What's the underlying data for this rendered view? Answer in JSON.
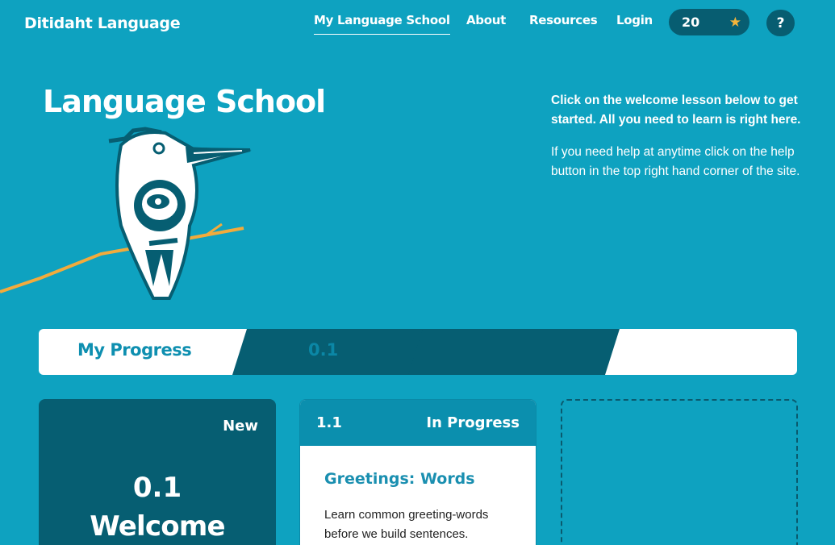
{
  "brand": "Ditidaht Language",
  "nav": {
    "items": [
      {
        "label": "My Language School",
        "active": true
      },
      {
        "label": "About",
        "active": false
      },
      {
        "label": "Resources",
        "active": false
      },
      {
        "label": "Login",
        "active": false
      }
    ],
    "stars_count": "20",
    "help_label": "?"
  },
  "hero": {
    "title": "Language School",
    "intro_bold": "Click on the welcome lesson below to get started. All you need to learn is right here.",
    "intro_regular": "If you need help at anytime click on the help button in the top right hand corner of the site."
  },
  "progress": {
    "label": "My Progress",
    "segment_label": "0.1"
  },
  "cards": {
    "welcome": {
      "status": "New",
      "number": "0.1",
      "title": "Welcome"
    },
    "lesson": {
      "number": "1.1",
      "status": "In Progress",
      "title": "Greetings: Words",
      "description": "Learn common greeting-words before we build sentences."
    }
  },
  "colors": {
    "background": "#0ea2c0",
    "dark_teal": "#065e72",
    "star": "#f6b53a",
    "branch": "#f2ab3c"
  }
}
